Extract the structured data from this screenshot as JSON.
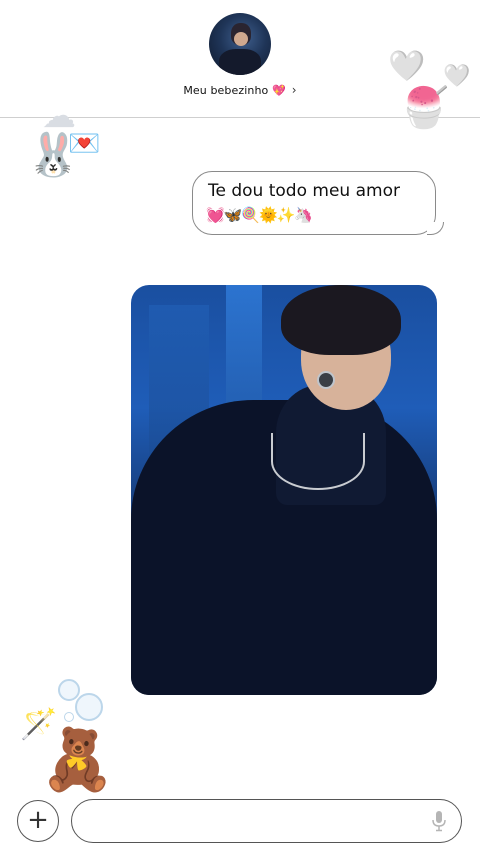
{
  "header": {
    "contact_name": "Meu bebezinho 💖",
    "chevron": "›"
  },
  "messages": [
    {
      "text": "Te dou todo meu amor",
      "emoji_line": "💓🦋🍭🌞✨🦄"
    }
  ],
  "photo": {
    "icon": "photo-attachment"
  },
  "stickers": {
    "heart_big": "🤍",
    "heart_small": "🤍",
    "shaved_ice": "🍧",
    "cloud": "☁",
    "rabbit": "🐰",
    "envelope": "💌",
    "wand": "🪄",
    "teddy": "🧸"
  },
  "composer": {
    "plus_label": "+",
    "input_value": "",
    "input_placeholder": ""
  },
  "colors": {
    "divider": "#cfcfcf",
    "bubble_border": "#8a8a8a",
    "text": "#111111"
  }
}
